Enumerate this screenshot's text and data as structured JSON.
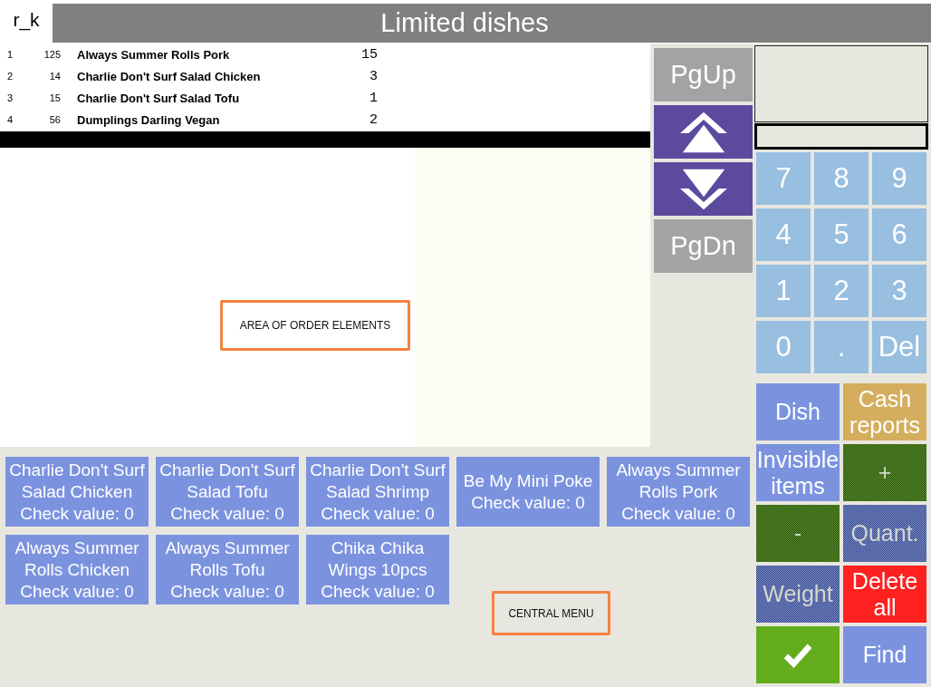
{
  "tab": {
    "label": "r_k"
  },
  "title": "Limited dishes",
  "order_list": {
    "rows": [
      {
        "number": "1",
        "code": "125",
        "name": "Always Summer Rolls Pork",
        "quantity": "15"
      },
      {
        "number": "2",
        "code": "14",
        "name": "Charlie Don't Surf Salad Chicken",
        "quantity": "3"
      },
      {
        "number": "3",
        "code": "15",
        "name": "Charlie Don't Surf Salad Tofu",
        "quantity": "1"
      },
      {
        "number": "4",
        "code": "56",
        "name": "Dumplings Darling Vegan",
        "quantity": "2"
      }
    ]
  },
  "order_area": {
    "annotation": "AREA OF ORDER ELEMENTS"
  },
  "navigation": [
    {
      "kind": "text",
      "label": "PgUp"
    },
    {
      "kind": "up"
    },
    {
      "kind": "down"
    },
    {
      "kind": "text",
      "label": "PgDn"
    }
  ],
  "central_menu": {
    "items": [
      {
        "name": "Charlie Don't Surf Salad Chicken",
        "check": "Check value: 0"
      },
      {
        "name": "Charlie Don't Surf Salad Tofu",
        "check": "Check value: 0"
      },
      {
        "name": "Charlie Don't Surf Salad Shrimp",
        "check": "Check value: 0"
      },
      {
        "name": "Be My Mini Poke",
        "check": "Check value: 0"
      },
      {
        "name": "Always Summer Rolls Pork",
        "check": "Check value: 0"
      },
      {
        "name": "Always Summer Rolls Chicken",
        "check": "Check value: 0"
      },
      {
        "name": "Always Summer Rolls Tofu",
        "check": "Check value: 0"
      },
      {
        "name": "Chika Chika Wings 10pcs",
        "check": "Check value: 0"
      }
    ],
    "annotation": "CENTRAL MENU"
  },
  "keypad": [
    "7",
    "8",
    "9",
    "4",
    "5",
    "6",
    "1",
    "2",
    "3",
    "0",
    ".",
    "Del"
  ],
  "function_buttons": [
    {
      "kind": "text",
      "label": "Dish",
      "color": "#7b93df",
      "disabled": false
    },
    {
      "kind": "text",
      "label": "Cash reports",
      "color": "#d4ae5e",
      "disabled": false
    },
    {
      "kind": "text",
      "label": "Invisible items",
      "color": "#7b93df",
      "disabled": false
    },
    {
      "kind": "text",
      "label": "+",
      "color": "#5c9c1c",
      "disabled": true
    },
    {
      "kind": "text",
      "label": "-",
      "color": "#5c9c1c",
      "disabled": true
    },
    {
      "kind": "text",
      "label": "Quant.",
      "color": "#7b93df",
      "disabled": true
    },
    {
      "kind": "text",
      "label": "Weight",
      "color": "#7b93df",
      "disabled": true
    },
    {
      "kind": "text",
      "label": "Delete all",
      "color": "#ff2020",
      "disabled": false
    },
    {
      "kind": "icon",
      "color": "#63ad1d",
      "disabled": false
    },
    {
      "kind": "text",
      "label": "Find",
      "color": "#7b93df",
      "disabled": false
    }
  ]
}
